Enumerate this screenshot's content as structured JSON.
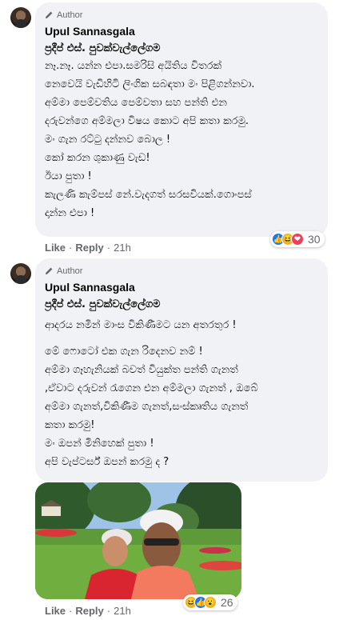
{
  "comments": [
    {
      "author_badge": "Author",
      "name": "Upul Sannasgala",
      "subname": "ප්‍රදීප් එස්. පුවක්වැල්ලේගම",
      "lines": [
        "නෑ.නෑ. යන්න එපා.සමරිසි අයිතිය විතරක්",
        "නෙවෙයි වැඩිහිටි ලිංගික සබඳතා මං පිළිගන්නවා.",
        "අම්මා පෙම්වතිය පෙම්වතා සහ පන්ති එන",
        "දරුවන්ගෙ අම්මලා විෂය කොට අපි කතා කරමු.",
        "මං ගැන රට්ටු දන්නව බොල !",
        "කෝ කරන ශුකාණු වැඩ!",
        "ඊයා පුතා !",
        "කැලණි කැම්පස් නේ.වැදගත් සරසවියක්.ගොංපස්",
        "දාන්න එපා !"
      ],
      "reaction_count": "30",
      "reactions": [
        "like-icon",
        "haha-icon",
        "love-icon"
      ],
      "actions": {
        "like": "Like",
        "reply": "Reply",
        "time": "21h"
      }
    },
    {
      "author_badge": "Author",
      "name": "Upul Sannasgala",
      "subname": "ප්‍රදීප් එස්. පුවක්වැල්ලේගම",
      "lines": [
        "ආදරය නමින් මාංස විකිණීමට යන අතරතුර !",
        "",
        "මේ ෆොටෝ එක ගැන රිදෙනව නම් !",
        "අම්මා ගෑහැනියක් බවත් වියුක්ත පන්ති ගැනත්",
        ",ඒවාට දරුවන් රැගෙන එන අම්මලා ගැනත් , ඔබේ",
        "අම්මා ගැනත්,විකිණීම ගැනත්,සංස්කෘතිය ගැනත්",
        "කතා කරමු!",
        "මං ඔපන් මිනිහෙක් පුතා !",
        "අපි වැප්ටර්ස් ඔපන් කරමු ද ?"
      ],
      "reaction_count": "26",
      "reactions": [
        "haha-icon",
        "like-icon",
        "wow-icon"
      ],
      "actions": {
        "like": "Like",
        "reply": "Reply",
        "time": "21h"
      }
    }
  ],
  "colors": {
    "bubble": "#f0f2f5",
    "meta": "#65676b",
    "text": "#050505",
    "like": "#1877f2",
    "love": "#f33e58",
    "haha": "#f7b125"
  }
}
